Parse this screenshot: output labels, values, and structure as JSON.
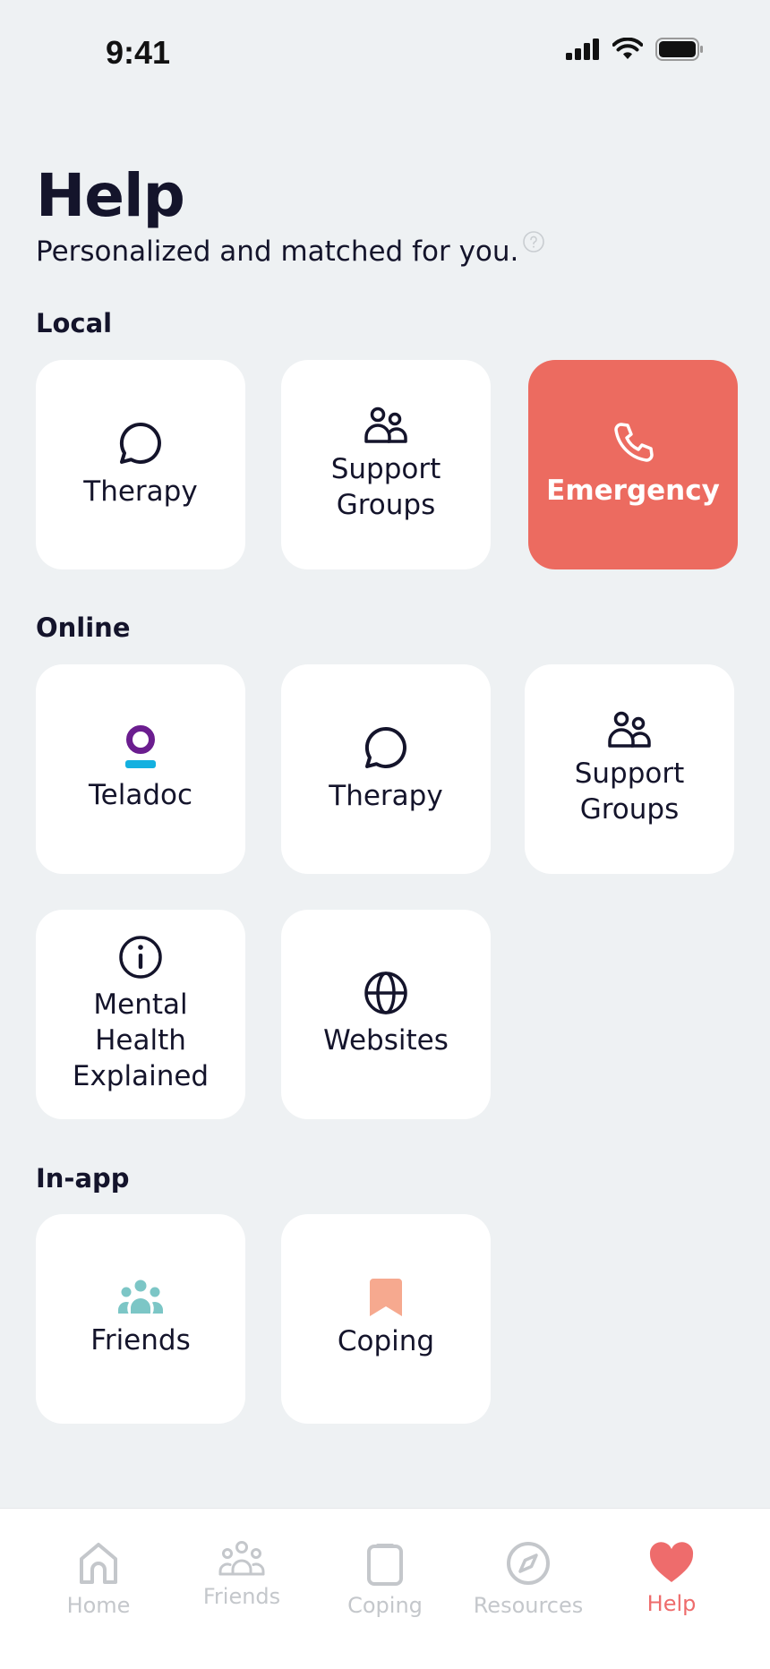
{
  "status_bar": {
    "time": "9:41"
  },
  "header": {
    "title": "Help",
    "subtitle": "Personalized and matched for you."
  },
  "sections": {
    "local": {
      "label": "Local",
      "tiles": [
        {
          "label": "Therapy",
          "icon": "speech-bubble-icon"
        },
        {
          "label_lines": [
            "Support",
            "Groups"
          ],
          "icon": "people-icon"
        },
        {
          "label": "Emergency",
          "icon": "phone-icon"
        }
      ]
    },
    "online": {
      "label": "Online",
      "tiles": [
        {
          "label": "Teladoc",
          "icon": "teladoc-logo-icon"
        },
        {
          "label": "Therapy",
          "icon": "speech-bubble-icon"
        },
        {
          "label_lines": [
            "Support",
            "Groups"
          ],
          "icon": "people-icon"
        },
        {
          "label_lines": [
            "Mental",
            "Health",
            "Explained"
          ],
          "icon": "info-icon"
        },
        {
          "label": "Websites",
          "icon": "globe-icon"
        }
      ]
    },
    "inapp": {
      "label": "In-app",
      "tiles": [
        {
          "label": "Friends",
          "icon": "friends-group-icon"
        },
        {
          "label": "Coping",
          "icon": "bookmark-icon"
        }
      ]
    }
  },
  "tab_bar": {
    "items": [
      {
        "label": "Home",
        "icon": "home-icon",
        "active": false
      },
      {
        "label": "Friends",
        "icon": "friends-icon",
        "active": false
      },
      {
        "label": "Coping",
        "icon": "clipboard-icon",
        "active": false
      },
      {
        "label": "Resources",
        "icon": "compass-icon",
        "active": false
      },
      {
        "label": "Help",
        "icon": "heart-icon",
        "active": true
      }
    ]
  },
  "colors": {
    "background": "#eef1f3",
    "tile": "#ffffff",
    "emergency": "#ec6b60",
    "text": "#14142b",
    "teladoc_purple": "#6b1d8f",
    "teladoc_blue": "#14b0e0",
    "friends_teal": "#7cc6c6",
    "coping_peach": "#f6a98f",
    "tab_inactive": "#c4c7cb",
    "tab_active": "#ee6c6c"
  }
}
